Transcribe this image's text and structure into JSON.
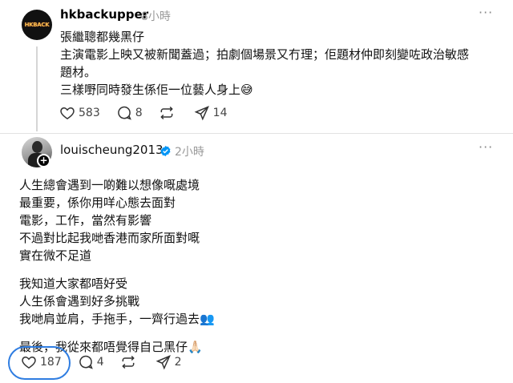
{
  "post1": {
    "username": "hkbackupper",
    "time": "8小時",
    "avatar_text": "HKBACK",
    "lines": [
      "張繼聰都幾黑仔",
      "主演電影上映又被新聞蓋過；拍劇個場景又冇理；佢題材仲即刻變咗政治敏感",
      "題材。",
      "三樣嘢同時發生係佢一位藝人身上😅"
    ],
    "likes": "583",
    "comments": "8",
    "shares": "14"
  },
  "post2": {
    "username": "louischeung2013",
    "time": "2小時",
    "paragraphs": [
      [
        "人生總會遇到一啲難以想像嘅處境",
        "最重要，係你用咩心態去面對",
        "電影，工作，當然有影響",
        "不過對比起我哋香港而家所面對嘅",
        "實在微不足道"
      ],
      [
        "我知道大家都唔好受",
        "人生係會遇到好多挑戰",
        "我哋肩並肩，手拖手，一齊行過去👥"
      ],
      [
        "最後，我從來都唔覺得自己黑仔🙏🏻"
      ]
    ],
    "likes": "187",
    "comments": "4",
    "shares": "2"
  },
  "ui": {
    "more": "···",
    "plus": "+"
  },
  "colors": {
    "verified": "#0095f6",
    "highlight": "#2f7de1"
  }
}
